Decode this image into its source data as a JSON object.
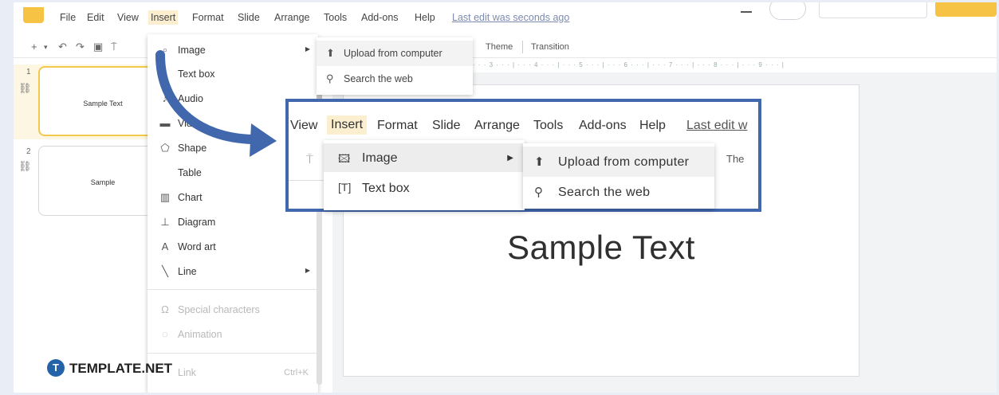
{
  "menubar": {
    "items": [
      "File",
      "Edit",
      "View",
      "Insert",
      "Format",
      "Slide",
      "Arrange",
      "Tools",
      "Add-ons",
      "Help"
    ],
    "last_edit": "Last edit was seconds ago"
  },
  "toolbar": {
    "tab_theme": "Theme",
    "tab_transition": "Transition"
  },
  "ruler": "· · · 3 · · · | · · · 4 · · · | · · · 5 · · · | · · · 6 · · · | · · · 7 · · · | · · · 8 · · · | · · · 9 · · · |",
  "slides": [
    {
      "number": "1",
      "text": "Sample Text"
    },
    {
      "number": "2",
      "text": "Sample"
    }
  ],
  "canvas": {
    "title": "Sample Text"
  },
  "insert_menu": {
    "items": [
      {
        "icon": "image-icon",
        "label": "Image",
        "submenu": true
      },
      {
        "icon": "",
        "label": "Text box"
      },
      {
        "icon": "audio-icon",
        "label": "Audio"
      },
      {
        "icon": "video-icon",
        "label": "Video"
      },
      {
        "icon": "shape-icon",
        "label": "Shape",
        "submenu": true
      },
      {
        "icon": "",
        "label": "Table",
        "submenu": true
      },
      {
        "icon": "chart-icon",
        "label": "Chart",
        "submenu": true
      },
      {
        "icon": "diagram-icon",
        "label": "Diagram"
      },
      {
        "icon": "word-art-icon",
        "label": "Word art"
      },
      {
        "icon": "line-icon",
        "label": "Line",
        "submenu": true
      }
    ],
    "disabled_items": [
      {
        "icon": "special-characters-icon",
        "label": "Special characters"
      },
      {
        "icon": "animation-icon",
        "label": "Animation"
      }
    ],
    "link": {
      "label": "Link",
      "shortcut": "Ctrl+K"
    }
  },
  "image_submenu": {
    "items": [
      {
        "icon": "upload-icon",
        "label": "Upload from computer"
      },
      {
        "icon": "search-icon",
        "label": "Search the web"
      }
    ]
  },
  "zoom": {
    "menubar": [
      "View",
      "Insert",
      "Format",
      "Slide",
      "Arrange",
      "Tools",
      "Add-ons",
      "Help"
    ],
    "last_edit": "Last edit w",
    "theme_partial": "The",
    "dropdown": [
      {
        "label": "Image"
      },
      {
        "label": "Text box"
      }
    ],
    "submenu": [
      {
        "label": "Upload from computer"
      },
      {
        "label": "Search the web"
      }
    ]
  },
  "watermark": {
    "badge": "T",
    "text": "TEMPLATE.NET"
  },
  "colors": {
    "accent_blue": "#4167ad",
    "highlight_yellow": "#fbefd0",
    "brand_yellow": "#f6c344"
  }
}
